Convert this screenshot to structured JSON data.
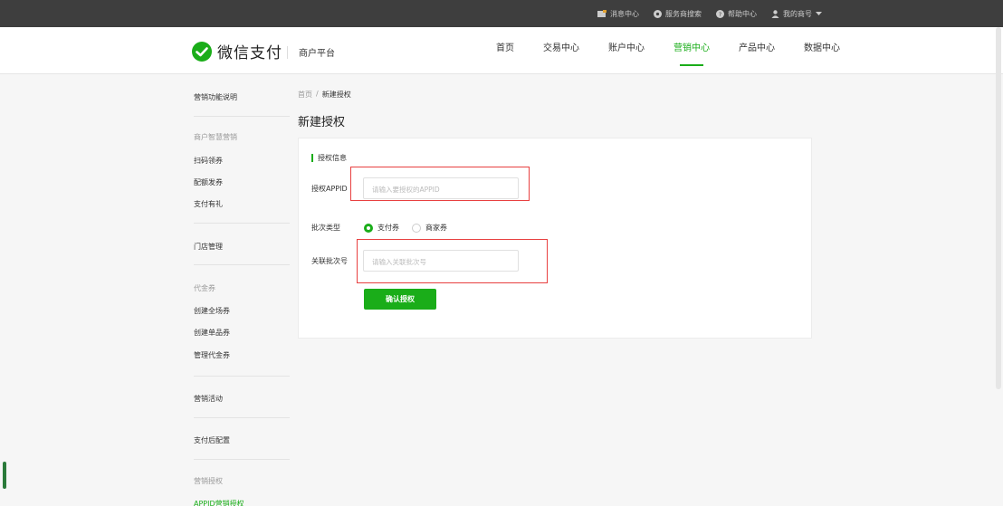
{
  "topbar": {
    "links": [
      {
        "label": "消息中心",
        "icon": "message-icon"
      },
      {
        "label": "服务商搜索",
        "icon": "search-service-icon"
      },
      {
        "label": "帮助中心",
        "icon": "help-icon"
      },
      {
        "label": "我的商号",
        "icon": "user-icon"
      }
    ]
  },
  "header": {
    "logo_text": "微信支付",
    "platform": "商户平台",
    "nav": [
      "首页",
      "交易中心",
      "账户中心",
      "营销中心",
      "产品中心",
      "数据中心"
    ],
    "active_nav": "营销中心"
  },
  "sidebar": {
    "items": [
      {
        "label": "营销功能说明",
        "style": "normal"
      },
      {
        "label": "商户智慧营销",
        "style": "muted"
      },
      {
        "label": "扫码领券",
        "style": "normal"
      },
      {
        "label": "配额发券",
        "style": "normal"
      },
      {
        "label": "支付有礼",
        "style": "normal"
      },
      {
        "label": "门店管理",
        "style": "normal"
      },
      {
        "label": "代金券",
        "style": "muted"
      },
      {
        "label": "创建全场券",
        "style": "normal"
      },
      {
        "label": "创建单品券",
        "style": "normal"
      },
      {
        "label": "管理代金券",
        "style": "normal"
      },
      {
        "label": "营销活动",
        "style": "normal"
      },
      {
        "label": "支付后配置",
        "style": "normal"
      },
      {
        "label": "营销授权",
        "style": "muted"
      },
      {
        "label": "APPID营销授权",
        "style": "active"
      }
    ]
  },
  "breadcrumb": {
    "home": "首页",
    "sep": "/",
    "current": "新建授权"
  },
  "page_title": "新建授权",
  "form": {
    "section_title": "授权信息",
    "appid_label": "授权APPID",
    "appid_placeholder": "请输入要授权的APPID",
    "batch_type_label": "批次类型",
    "batch_type_options": [
      "支付券",
      "商家券"
    ],
    "batch_type_selected": "支付券",
    "batch_no_label": "关联批次号",
    "batch_no_placeholder": "请输入关联批次号",
    "submit_label": "确认授权"
  },
  "colors": {
    "accent": "#1aad19",
    "highlight": "#e84040",
    "topbar": "#3e3e3e"
  }
}
